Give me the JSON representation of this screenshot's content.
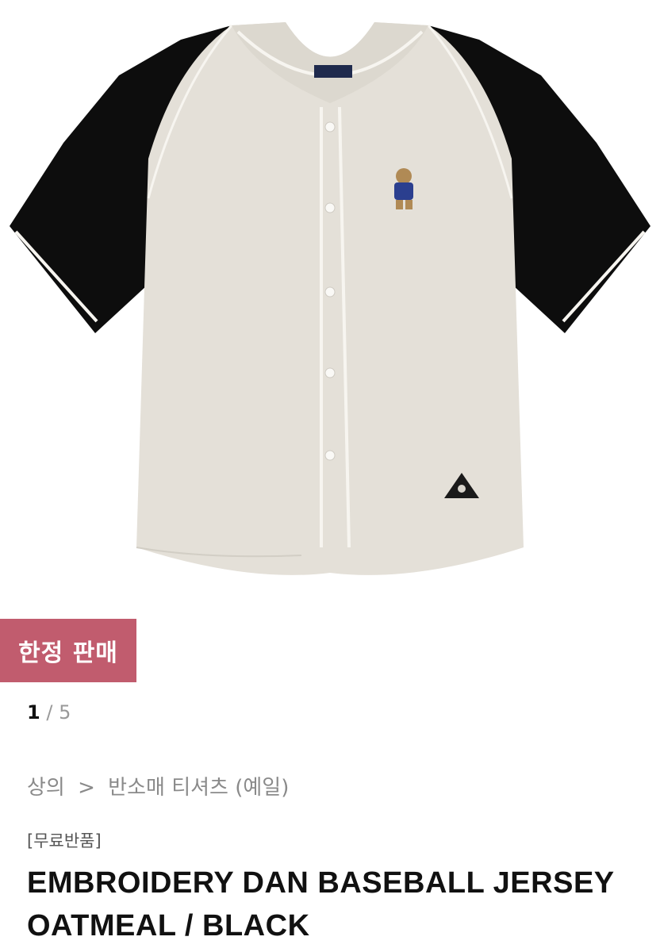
{
  "product": {
    "image_alt": "Baseball jersey, oatmeal body with black raglan sleeves",
    "badge": "한정 판매",
    "pager": {
      "current": "1",
      "separator": "/",
      "total": "5"
    },
    "breadcrumb": {
      "category": "상의",
      "separator": ">",
      "subcategory": "반소매 티셔츠 (예일)"
    },
    "tag": "[무료반품]",
    "title_line1": "EMBROIDERY DAN BASEBALL JERSEY",
    "title_line2": "OATMEAL / BLACK"
  },
  "colors": {
    "badge_bg": "#c15c6e",
    "body": "#e4e0d8",
    "sleeve": "#0d0d0d",
    "piping": "#f7f5f0"
  }
}
